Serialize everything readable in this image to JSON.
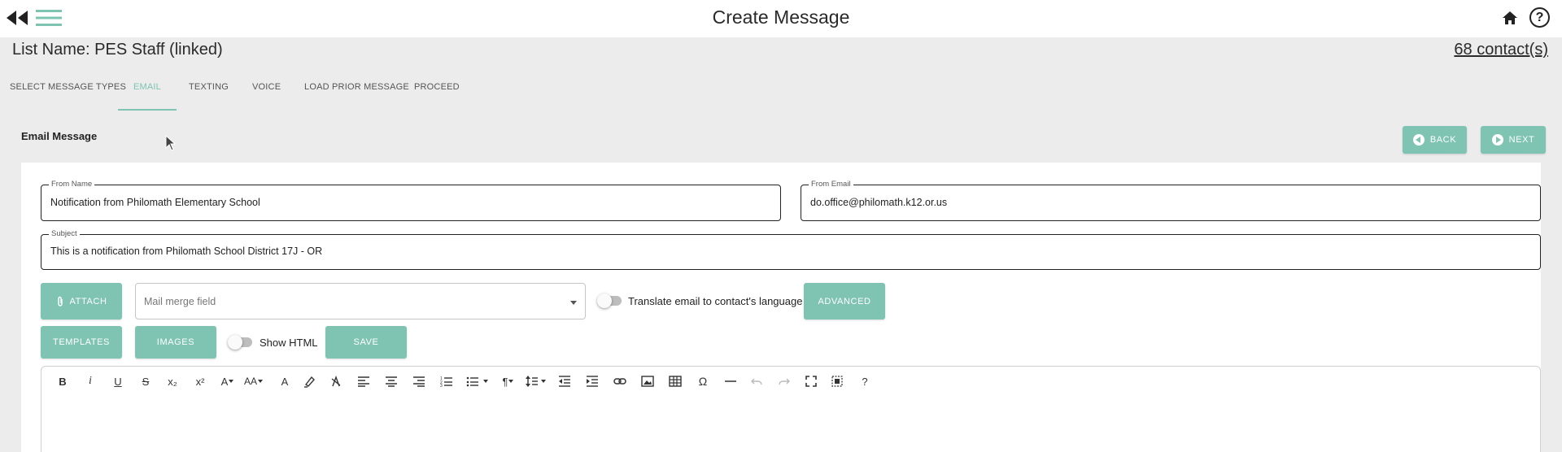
{
  "header": {
    "title": "Create Message",
    "help_label": "?"
  },
  "list": {
    "name": "List Name: PES Staff (linked)",
    "contacts": "68 contact(s)"
  },
  "tabs": [
    {
      "label": "SELECT MESSAGE TYPES",
      "active": false
    },
    {
      "label": "EMAIL",
      "active": true
    },
    {
      "label": "TEXTING",
      "active": false
    },
    {
      "label": "VOICE",
      "active": false
    },
    {
      "label": "LOAD PRIOR MESSAGE",
      "active": false
    },
    {
      "label": "PROCEED",
      "active": false
    }
  ],
  "section": {
    "title": "Email Message",
    "back_label": "BACK",
    "next_label": "NEXT"
  },
  "form": {
    "from_name_label": "From Name",
    "from_name_value": "Notification from Philomath Elementary School",
    "from_email_label": "From Email",
    "from_email_value": "do.office@philomath.k12.or.us",
    "subject_label": "Subject",
    "subject_value": "This is a notification from Philomath School District 17J - OR"
  },
  "actions": {
    "attach_label": "ATTACH",
    "mail_merge_placeholder": "Mail merge field",
    "translate_label": "Translate email to contact's language",
    "translate_on": false,
    "advanced_label": "ADVANCED",
    "templates_label": "TEMPLATES",
    "images_label": "IMAGES",
    "show_html_label": "Show HTML",
    "show_html_on": false,
    "save_label": "SAVE"
  },
  "editor_toolbar": {
    "bold": "B",
    "italic": "i",
    "underline": "U",
    "strikethrough": "S",
    "subscript": "x₂",
    "superscript": "x²",
    "font_family": "A",
    "font_size": "AA",
    "text_color": "A",
    "special_chars": "Ω",
    "paragraph_format": "¶",
    "help": "?"
  },
  "colors": {
    "accent": "#7fc4b3",
    "background": "#ececec"
  }
}
